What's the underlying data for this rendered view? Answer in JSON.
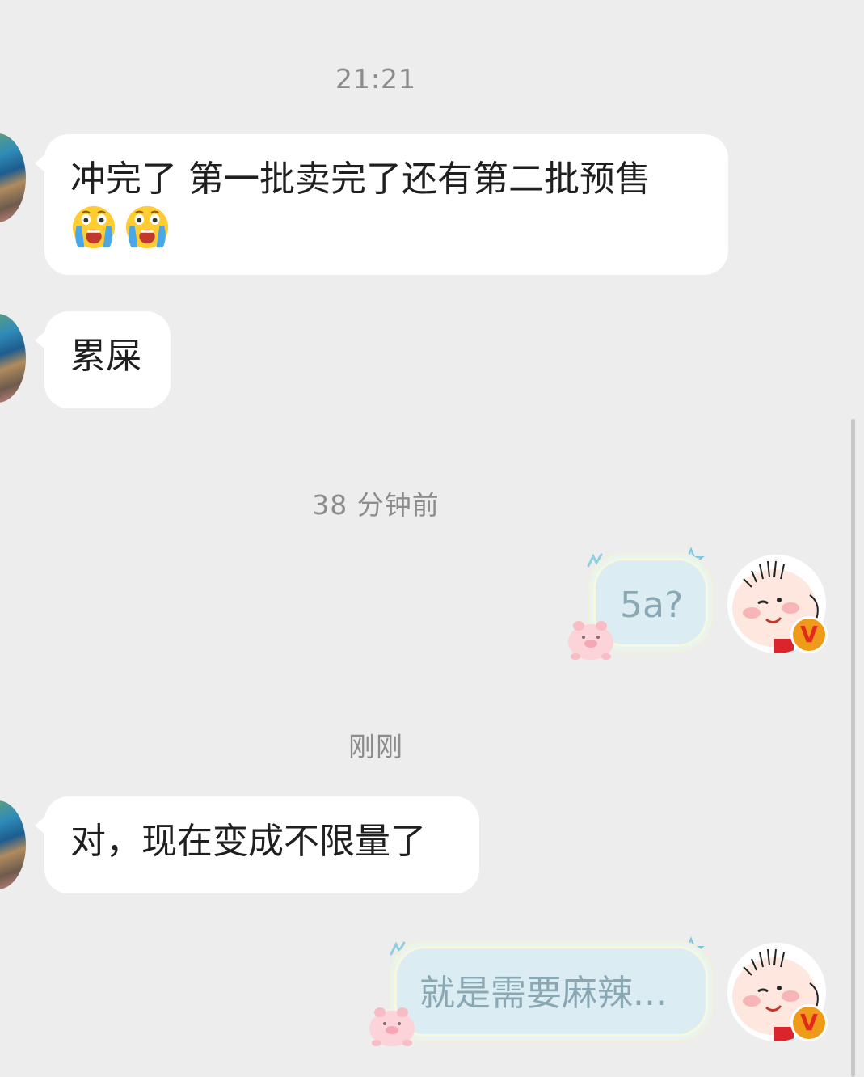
{
  "timestamps": {
    "t1": "21:21",
    "t2": "38 分钟前",
    "t3": "刚刚"
  },
  "messages": {
    "m1_text": "冲完了 第一批卖完了还有第二批预售",
    "m1_emojis": [
      "loudly-crying-face",
      "loudly-crying-face"
    ],
    "m2_text": "累屎",
    "m3_text": "5a?",
    "m4_text": "对，现在变成不限量了",
    "m5_text": "就是需要麻辣..."
  },
  "badges": {
    "vip_label": "V"
  },
  "colors": {
    "background": "#ededed",
    "incoming_bubble": "#ffffff",
    "outgoing_bubble": "#dcecf3",
    "outgoing_text": "#8aa8b3",
    "timestamp_text": "#8c8c8c",
    "badge_orange": "#f09a1a"
  }
}
